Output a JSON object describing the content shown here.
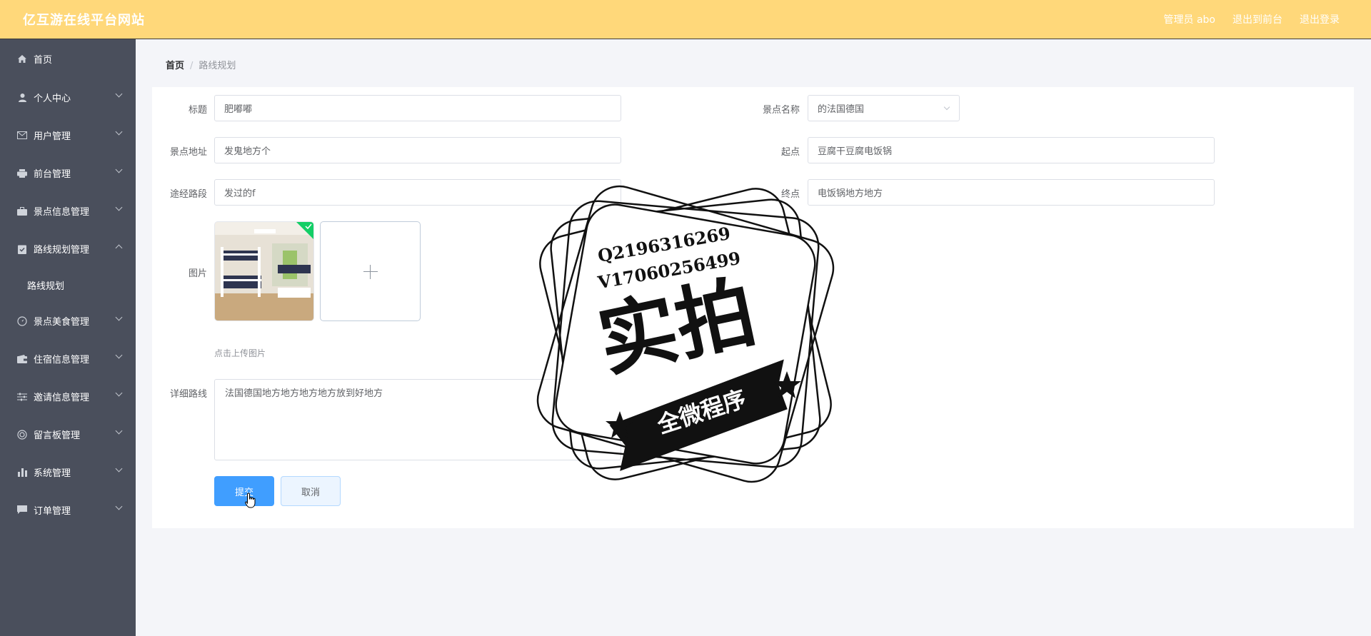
{
  "header": {
    "title": "亿互游在线平台网站",
    "admin": "管理员 abo",
    "front_link": "退出到前台",
    "logout": "退出登录"
  },
  "sidebar": {
    "items": [
      {
        "label": "首页",
        "icon": "home-icon"
      },
      {
        "label": "个人中心",
        "icon": "user-icon"
      },
      {
        "label": "用户管理",
        "icon": "mail-icon"
      },
      {
        "label": "前台管理",
        "icon": "printer-icon"
      },
      {
        "label": "景点信息管理",
        "icon": "briefcase-icon"
      },
      {
        "label": "路线规划管理",
        "icon": "clipboard-icon",
        "expanded": true
      },
      {
        "label": "景点美食管理",
        "icon": "compass-icon"
      },
      {
        "label": "住宿信息管理",
        "icon": "wallet-icon"
      },
      {
        "label": "邀请信息管理",
        "icon": "sliders-icon"
      },
      {
        "label": "留言板管理",
        "icon": "settings-circle-icon"
      },
      {
        "label": "系统管理",
        "icon": "bar-chart-icon"
      },
      {
        "label": "订单管理",
        "icon": "chat-icon"
      }
    ],
    "sub_item": "路线规划"
  },
  "breadcrumb": {
    "home": "首页",
    "separator": "/",
    "current": "路线规划"
  },
  "form": {
    "title_label": "标题",
    "title_value": "肥嘟嘟",
    "spot_name_label": "景点名称",
    "spot_name_value": "的法国德国",
    "address_label": "景点地址",
    "address_value": "发鬼地方个",
    "start_label": "起点",
    "start_value": "豆腐干豆腐电饭锅",
    "via_label": "途经路段",
    "via_value": "发过的f",
    "end_label": "终点",
    "end_value": "电饭锅地方地方",
    "image_label": "图片",
    "upload_tip": "点击上传图片",
    "detail_label": "详细路线",
    "detail_value": "法国德国地方地方地方地方放到好地方",
    "submit": "提交",
    "cancel": "取消"
  },
  "watermark": {
    "qq": "Q2196316269",
    "v": "V17060256499",
    "big": "实拍",
    "ribbon": "全微程序"
  },
  "colors": {
    "header_bg": "#ffd87a",
    "sidebar_bg": "#4a4f5c",
    "primary": "#409eff"
  }
}
